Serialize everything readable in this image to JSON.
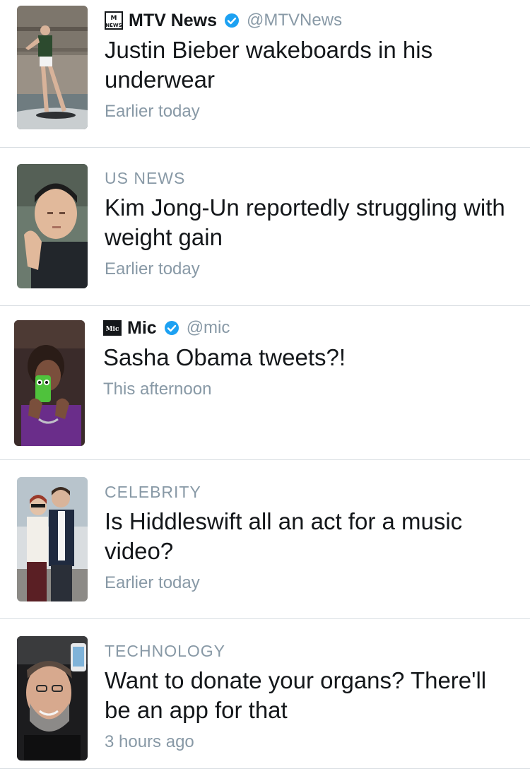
{
  "items": [
    {
      "source": {
        "name": "MTV News",
        "handle": "@MTVNews",
        "logo_icon": "mtv-news-logo-icon",
        "verified": true
      },
      "headline": "Justin Bieber wakeboards in his underwear",
      "time": "Earlier today",
      "thumbnail": "wakeboarder-photo"
    },
    {
      "category": "US NEWS",
      "headline": "Kim Jong-Un reportedly struggling with weight gain",
      "time": "Earlier today",
      "thumbnail": "leader-clapping-photo"
    },
    {
      "source": {
        "name": "Mic",
        "handle": "@mic",
        "logo_icon": "mic-logo-icon",
        "verified": true
      },
      "headline": "Sasha Obama tweets?!",
      "time": "This afternoon",
      "thumbnail": "girl-with-frog-phone-case-photo"
    },
    {
      "category": "CELEBRITY",
      "headline": "Is Hiddleswift all an act for a music video?",
      "time": "Earlier today",
      "thumbnail": "couple-walking-photo"
    },
    {
      "category": "TECHNOLOGY",
      "headline": "Want to donate your organs? There'll be an app for that",
      "time": "3 hours ago",
      "thumbnail": "man-smiling-with-phone-photo"
    }
  ],
  "colors": {
    "secondary_text": "#8899a6",
    "primary_text": "#14171a",
    "verified_blue": "#1da1f2",
    "divider": "#d8dde2"
  }
}
